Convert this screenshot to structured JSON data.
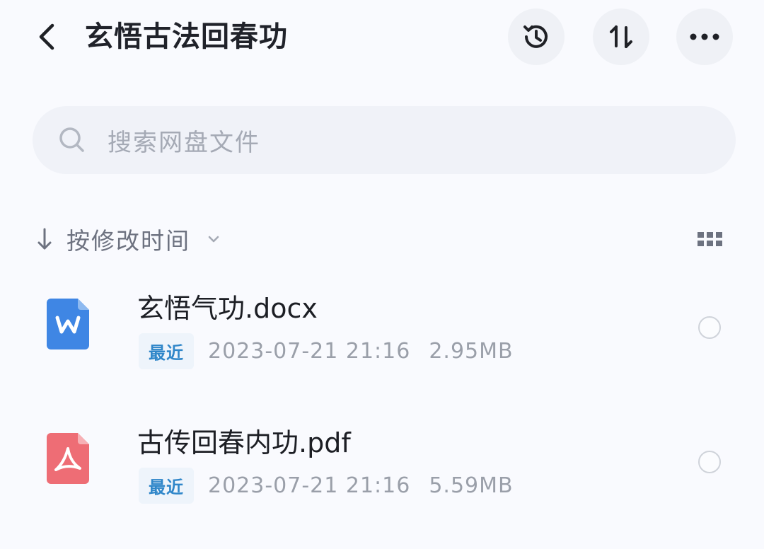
{
  "header": {
    "title": "玄悟古法回春功",
    "back_icon": "chevron-left-icon",
    "actions": [
      {
        "name": "history",
        "icon": "history-icon"
      },
      {
        "name": "sort",
        "icon": "sort-arrows-icon"
      },
      {
        "name": "more",
        "icon": "more-horizontal-icon"
      }
    ]
  },
  "search": {
    "placeholder": "搜索网盘文件",
    "icon": "search-icon"
  },
  "sort": {
    "label": "按修改时间",
    "direction_icon": "arrow-down-icon",
    "dropdown_icon": "chevron-down-icon",
    "view_toggle_icon": "grid-view-icon"
  },
  "files": [
    {
      "name": "玄悟气功.docx",
      "type_icon": "word-file-icon",
      "badge": "最近",
      "date": "2023-07-21  21:16",
      "size": "2.95MB",
      "selected": false
    },
    {
      "name": "古传回春内功.pdf",
      "type_icon": "pdf-file-icon",
      "badge": "最近",
      "date": "2023-07-21  21:16",
      "size": "5.59MB",
      "selected": false
    }
  ],
  "colors": {
    "background": "#f9fafe",
    "word_blue": "#3f86e4",
    "pdf_red": "#ee6d75",
    "badge_text": "#2f86c9",
    "muted_text": "#9a9fa9"
  }
}
